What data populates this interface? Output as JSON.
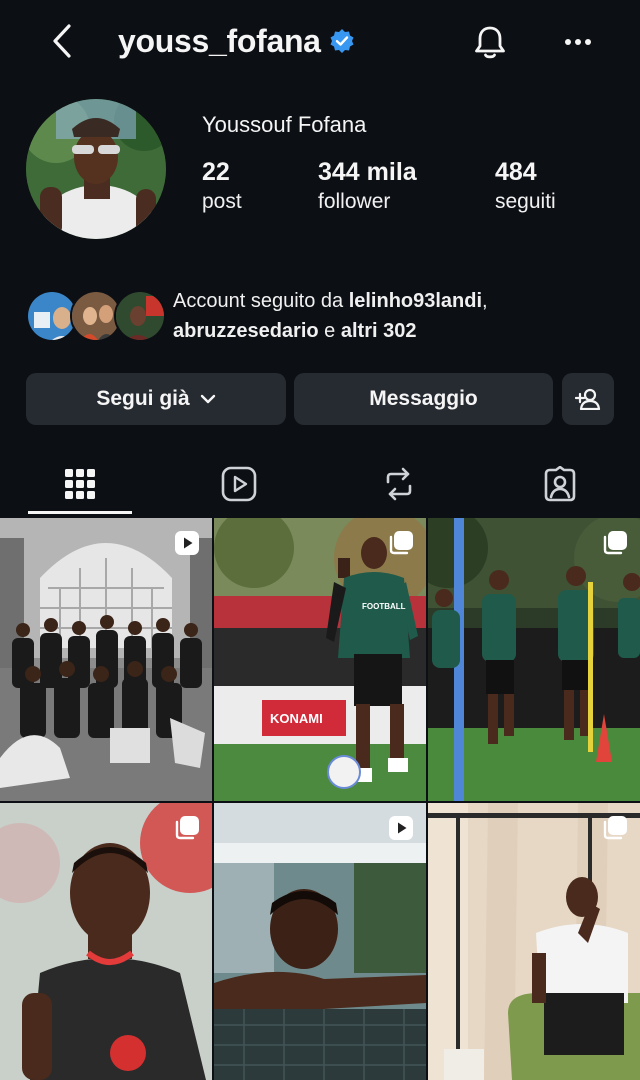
{
  "header": {
    "username": "youss_fofana",
    "back_icon": "chevron-left-icon",
    "verified_icon": "verified-badge-icon",
    "notifications_icon": "bell-icon",
    "more_icon": "more-horizontal-icon",
    "verified_color": "#3897f0"
  },
  "profile": {
    "full_name": "Youssouf Fofana",
    "stats": [
      {
        "value": "22",
        "label": "post"
      },
      {
        "value": "344 mila",
        "label": "follower"
      },
      {
        "value": "484",
        "label": "seguiti"
      }
    ]
  },
  "mutual": {
    "prefix": "Account seguito da ",
    "user1": "lelinho93landi",
    "sep": ",",
    "user2": "abruzzesedario",
    "conj": " e ",
    "others": "altri 302"
  },
  "actions": {
    "following_label": "Segui già",
    "message_label": "Messaggio",
    "add_user_icon": "person-add-icon"
  },
  "tabs": [
    {
      "name": "grid",
      "icon": "grid-icon",
      "active": true
    },
    {
      "name": "reels",
      "icon": "reels-icon",
      "active": false
    },
    {
      "name": "reposts",
      "icon": "repost-icon",
      "active": false
    },
    {
      "name": "tagged",
      "icon": "tagged-icon",
      "active": false
    }
  ],
  "posts": [
    {
      "type": "reel",
      "badge_icon": "reel-icon"
    },
    {
      "type": "carousel",
      "badge_icon": "carousel-icon"
    },
    {
      "type": "carousel",
      "badge_icon": "carousel-icon"
    },
    {
      "type": "carousel",
      "badge_icon": "carousel-icon"
    },
    {
      "type": "reel",
      "badge_icon": "reel-icon"
    },
    {
      "type": "carousel",
      "badge_icon": "carousel-icon"
    }
  ],
  "post_text": {
    "kit_sponsor": "FOOTBALL",
    "board_brand": "KONAMI"
  },
  "colors": {
    "background": "#0c0f14",
    "button": "#262a31",
    "kit_green": "#1f5a4a",
    "kit_red": "#d0312d"
  }
}
